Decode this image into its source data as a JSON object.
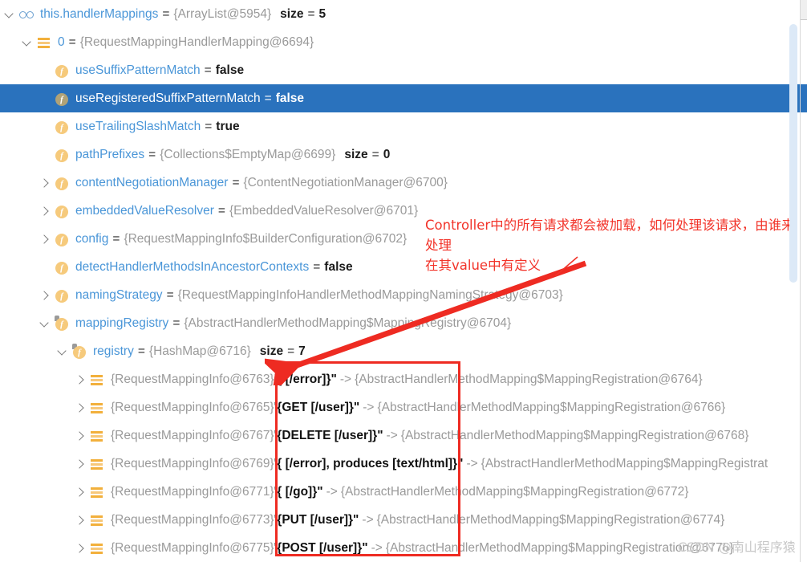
{
  "app": "IntelliJ IDEA Debugger Variables Panel",
  "tree": {
    "rows": [
      {
        "indent": 0,
        "chevron": "down",
        "icon": "watch-icon",
        "name": "this.handlerMappings",
        "eq": "=",
        "value": "{ArrayList@5954}",
        "size_key": "size",
        "size_eq": "=",
        "size_value": "5",
        "selected": false
      },
      {
        "indent": 1,
        "chevron": "down",
        "icon": "array-icon",
        "name": "0",
        "eq": "=",
        "value": "{RequestMappingHandlerMapping@6694}",
        "selected": false
      },
      {
        "indent": 2,
        "chevron": "none",
        "icon": "field-icon",
        "name": "useSuffixPatternMatch",
        "eq": "=",
        "literal": "false",
        "selected": false
      },
      {
        "indent": 2,
        "chevron": "none",
        "icon": "field-icon",
        "name": "useRegisteredSuffixPatternMatch",
        "eq": "=",
        "literal": "false",
        "selected": true
      },
      {
        "indent": 2,
        "chevron": "none",
        "icon": "field-icon",
        "name": "useTrailingSlashMatch",
        "eq": "=",
        "literal": "true",
        "selected": false
      },
      {
        "indent": 2,
        "chevron": "none",
        "icon": "field-icon",
        "name": "pathPrefixes",
        "eq": "=",
        "value": "{Collections$EmptyMap@6699}",
        "size_key": "size",
        "size_eq": "=",
        "size_value": "0",
        "selected": false
      },
      {
        "indent": 2,
        "chevron": "right",
        "icon": "field-icon",
        "name": "contentNegotiationManager",
        "eq": "=",
        "value": "{ContentNegotiationManager@6700}",
        "selected": false
      },
      {
        "indent": 2,
        "chevron": "right",
        "icon": "field-icon",
        "name": "embeddedValueResolver",
        "eq": "=",
        "value": "{EmbeddedValueResolver@6701}",
        "selected": false
      },
      {
        "indent": 2,
        "chevron": "right",
        "icon": "field-icon",
        "name": "config",
        "eq": "=",
        "value": "{RequestMappingInfo$BuilderConfiguration@6702}",
        "selected": false
      },
      {
        "indent": 2,
        "chevron": "none",
        "icon": "field-icon",
        "name": "detectHandlerMethodsInAncestorContexts",
        "eq": "=",
        "literal": "false",
        "selected": false
      },
      {
        "indent": 2,
        "chevron": "right",
        "icon": "field-icon",
        "name": "namingStrategy",
        "eq": "=",
        "value": "{RequestMappingInfoHandlerMethodMappingNamingStrategy@6703}",
        "selected": false
      },
      {
        "indent": 2,
        "chevron": "down",
        "icon": "field-private-icon",
        "name": "mappingRegistry",
        "eq": "=",
        "value": "{AbstractHandlerMethodMapping$MappingRegistry@6704}",
        "selected": false
      },
      {
        "indent": 3,
        "chevron": "down",
        "icon": "field-private-icon",
        "name": "registry",
        "eq": "=",
        "value": "{HashMap@6716}",
        "size_key": "size",
        "size_eq": "=",
        "size_value": "7",
        "selected": false
      },
      {
        "indent": 4,
        "chevron": "right",
        "icon": "array-icon",
        "map_key": "{RequestMappingInfo@6763}",
        "map_string": "'{ [/error]}\"",
        "arrow": "->",
        "map_value": "{AbstractHandlerMethodMapping$MappingRegistration@6764}",
        "selected": false
      },
      {
        "indent": 4,
        "chevron": "right",
        "icon": "array-icon",
        "map_key": "{RequestMappingInfo@6765}",
        "map_string": "'{GET [/user]}\"",
        "arrow": "->",
        "map_value": "{AbstractHandlerMethodMapping$MappingRegistration@6766}",
        "selected": false
      },
      {
        "indent": 4,
        "chevron": "right",
        "icon": "array-icon",
        "map_key": "{RequestMappingInfo@6767}",
        "map_string": "'{DELETE [/user]}\"",
        "arrow": "->",
        "map_value": "{AbstractHandlerMethodMapping$MappingRegistration@6768}",
        "selected": false
      },
      {
        "indent": 4,
        "chevron": "right",
        "icon": "array-icon",
        "map_key": "{RequestMappingInfo@6769}",
        "map_string": "'{ [/error], produces [text/html]}\"",
        "arrow": "->",
        "map_value": "{AbstractHandlerMethodMapping$MappingRegistrat",
        "selected": false
      },
      {
        "indent": 4,
        "chevron": "right",
        "icon": "array-icon",
        "map_key": "{RequestMappingInfo@6771}",
        "map_string": "'{ [/go]}\"",
        "arrow": "->",
        "map_value": "{AbstractHandlerMethodMapping$MappingRegistration@6772}",
        "selected": false
      },
      {
        "indent": 4,
        "chevron": "right",
        "icon": "array-icon",
        "map_key": "{RequestMappingInfo@6773}",
        "map_string": "'{PUT [/user]}\"",
        "arrow": "->",
        "map_value": "{AbstractHandlerMethodMapping$MappingRegistration@6774}",
        "selected": false
      },
      {
        "indent": 4,
        "chevron": "right",
        "icon": "array-icon",
        "map_key": "{RequestMappingInfo@6775}",
        "map_string": "'{POST [/user]}\"",
        "arrow": "->",
        "map_value": "{AbstractHandlerMethodMapping$MappingRegistration@6776}",
        "selected": false
      }
    ]
  },
  "annotations": {
    "note_line1": "Controller中的所有请求都会被加载，如何处理该请求，由谁来处理",
    "note_line2": "在其value中有定义",
    "color": "#f2342a",
    "box_color": "#ee2b22"
  },
  "watermark": {
    "text": "CSDN @南山程序猿",
    "color": "#c8c8c8"
  },
  "colors": {
    "selection_blue": "#2a72bd",
    "name_blue": "#4a96d8",
    "value_gray": "#9a9a9a",
    "icon_orange": "#f6ca7c",
    "scrollbar_thumb": "#dce9f7"
  }
}
